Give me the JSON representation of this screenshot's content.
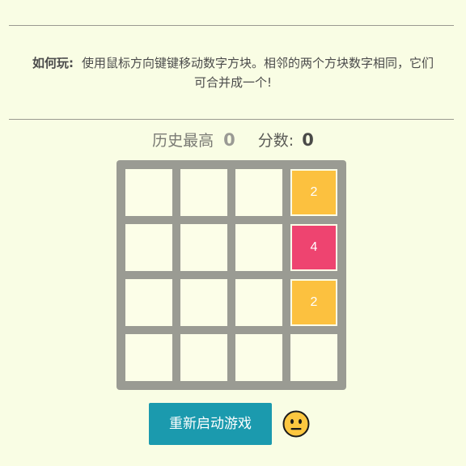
{
  "instructions": {
    "label": "如何玩:",
    "text": "使用鼠标方向键键移动数字方块。相邻的两个方块数字相同，它们可合并成一个!"
  },
  "scores": {
    "best_label": "历史最高",
    "best_value": "0",
    "score_label": "分数:",
    "score_value": "0"
  },
  "board": {
    "tiles": [
      {
        "row": 0,
        "col": 3,
        "value": "2",
        "color": "#fcc13f"
      },
      {
        "row": 1,
        "col": 3,
        "value": "4",
        "color": "#ee4470"
      },
      {
        "row": 2,
        "col": 3,
        "value": "2",
        "color": "#fcc13f"
      }
    ],
    "colors": {
      "board": "#9a9b93",
      "empty_cell": "#fcfee8"
    }
  },
  "restart": {
    "label": "重新启动游戏",
    "color": "#1b9aae"
  },
  "status_icon": "neutral-face-icon"
}
